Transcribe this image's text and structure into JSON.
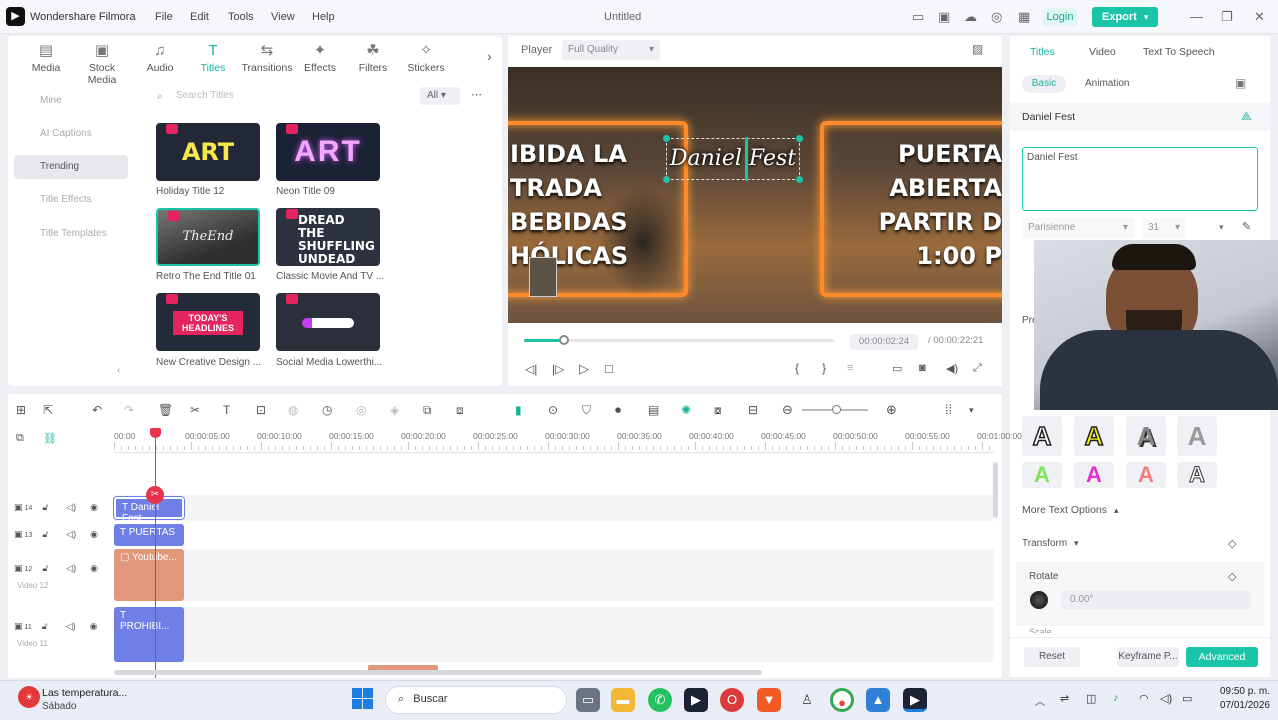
{
  "app": {
    "name": "Wondershare Filmora",
    "title": "Untitled"
  },
  "menu": [
    "File",
    "Edit",
    "Tools",
    "View",
    "Help"
  ],
  "header": {
    "login": "Login",
    "export": "Export"
  },
  "library": {
    "tabs": [
      {
        "label": "Media",
        "icon": "media-icon"
      },
      {
        "label": "Stock Media",
        "icon": "stock-media-icon"
      },
      {
        "label": "Audio",
        "icon": "audio-icon"
      },
      {
        "label": "Titles",
        "icon": "titles-icon"
      },
      {
        "label": "Transitions",
        "icon": "transitions-icon"
      },
      {
        "label": "Effects",
        "icon": "effects-icon"
      },
      {
        "label": "Filters",
        "icon": "filters-icon"
      },
      {
        "label": "Stickers",
        "icon": "stickers-icon"
      }
    ],
    "sidebar": [
      "Mine",
      "AI Captions",
      "Trending",
      "Title Effects",
      "Title Templates"
    ],
    "search_placeholder": "Search Titles",
    "filter": "All",
    "items": [
      {
        "label": "Holiday Title 12",
        "thumb": "ART"
      },
      {
        "label": "Neon Title 09",
        "thumb": "ART"
      },
      {
        "label": "Retro The End Title 01",
        "thumb": "TheEnd"
      },
      {
        "label": "Classic Movie And TV ...",
        "thumb": "DREAD THE SHUFFLING UNDEAD"
      },
      {
        "label": "New Creative Design ...",
        "thumb": "TODAY'S HEADLINES"
      },
      {
        "label": "Social Media Lowerthi...",
        "thumb": ""
      }
    ]
  },
  "player": {
    "label": "Player",
    "quality": "Full Quality",
    "current_time": "00:00:02:24",
    "total_time": "/ 00:00:22:21",
    "progress": 0.13,
    "overlay": {
      "left": [
        "IBIDA LA",
        "TRADA",
        "BEBIDAS",
        "HÓLICAS"
      ],
      "center": "Daniel Fest",
      "right": [
        "PUERTA",
        "ABIERTA",
        "PARTIR D",
        "1:00 P"
      ]
    }
  },
  "right_panel": {
    "tabs": [
      "Titles",
      "Video",
      "Text To Speech"
    ],
    "subtabs": [
      "Basic",
      "Animation"
    ],
    "title_name": "Daniel Fest",
    "text_value": "Daniel Fest",
    "font": "Parisienne",
    "font_size": "31",
    "pre_label": "Pre",
    "more_options": "More Text Options",
    "transform": "Transform",
    "rotate": "Rotate",
    "rotate_value": "0.00°",
    "scale": "Scale",
    "reset": "Reset",
    "keyframe": "Keyframe P...",
    "advanced": "Advanced"
  },
  "timeline": {
    "ruler": [
      "00:00",
      "00:00:05:00",
      "00:00:10:00",
      "00:00:15:00",
      "00:00:20:00",
      "00:00:25:00",
      "00:00:30:00",
      "00:00:35:00",
      "00:00:40:00",
      "00:00:45:00",
      "00:00:50:00",
      "00:00:55:00",
      "00:01:00:00"
    ],
    "tracks": [
      {
        "num": "14",
        "name": "",
        "clip": "Daniel Fest",
        "color": "#6f7fe6"
      },
      {
        "num": "13",
        "name": "",
        "clip": "PUERTAS",
        "color": "#6f7fe6"
      },
      {
        "num": "12",
        "name": "Video 12",
        "clip": "Youtube...",
        "color": "#e0977a"
      },
      {
        "num": "11",
        "name": "Video 11",
        "clip": "PROHIBI...",
        "color": "#6f7fe6"
      }
    ]
  },
  "taskbar": {
    "weather_title": "Las temperatura...",
    "weather_sub": "Sábado",
    "search": "Buscar",
    "time": "09:50 p. m.",
    "date": "07/01/2026"
  },
  "colors": {
    "accent": "#19c5a6",
    "title_clip": "#6f7fe6",
    "video_clip": "#e0977a",
    "playhead": "#e8344b"
  }
}
